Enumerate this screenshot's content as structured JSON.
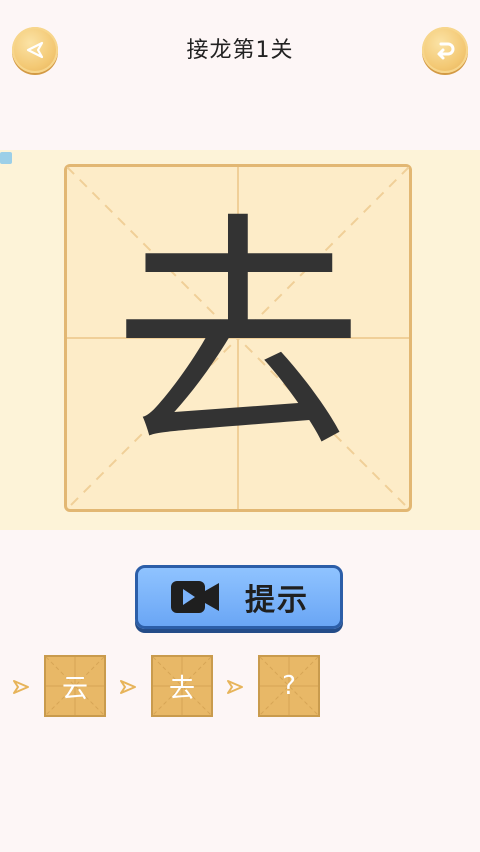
{
  "header": {
    "title": "接龙第1关",
    "back_icon": "back-arrow-icon",
    "reset_icon": "undo-icon"
  },
  "puzzle": {
    "current_char": "去"
  },
  "hint_button": {
    "label": "提示",
    "icon": "video-camera-icon"
  },
  "chain": {
    "items": [
      "云",
      "去",
      "?"
    ]
  },
  "colors": {
    "accent": "#f3c873",
    "grid_border": "#e2b773",
    "hint_blue": "#7bb3fb",
    "cell_fill": "#e8b867"
  }
}
